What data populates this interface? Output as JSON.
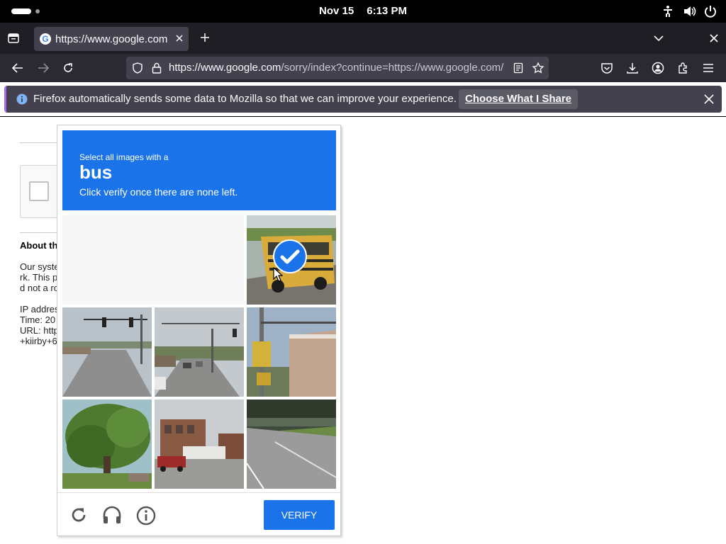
{
  "topbar": {
    "date": "Nov 15",
    "time": "6:13 PM",
    "icons": [
      "activities-indicator",
      "accessibility-icon",
      "volume-icon",
      "power-icon"
    ]
  },
  "browser": {
    "tab_title": "https://www.google.com",
    "url_host": "https://www.google.com",
    "url_path": "/sorry/index?continue=https://www.google.com/",
    "notification": {
      "message": "Firefox automatically sends some data to Mozilla so that we can improve your experience.",
      "button_label": "Choose What I Share"
    }
  },
  "page": {
    "about_heading": "About th",
    "body_lines": [
      "Our syste",
      "rk. This p",
      "d not a ro",
      "",
      "IP addres",
      "Time: 20",
      "URL: http",
      "+kiirby+6"
    ]
  },
  "captcha": {
    "prompt_line1": "Select all images with a",
    "prompt_target": "bus",
    "prompt_line3": "Click verify once there are none left.",
    "verify_label": "VERIFY",
    "accent_color": "#1a73e8",
    "tiles": [
      {
        "name": "tile-school-bus",
        "selected": true
      },
      {
        "name": "tile-traffic-light-road",
        "selected": false
      },
      {
        "name": "tile-street-intersection",
        "selected": false
      },
      {
        "name": "tile-traffic-signal-building",
        "selected": false
      },
      {
        "name": "tile-tree",
        "selected": false
      },
      {
        "name": "tile-brick-building-truck",
        "selected": false
      },
      {
        "name": "tile-road-curb",
        "selected": false
      }
    ],
    "footer_icons": [
      "reload-icon",
      "headphones-icon",
      "info-icon"
    ]
  }
}
